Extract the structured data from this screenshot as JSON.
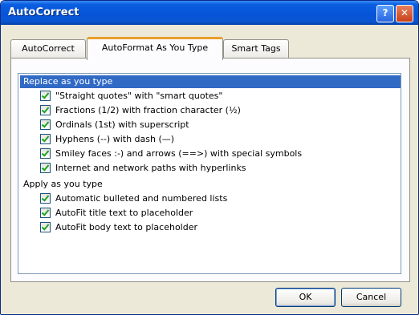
{
  "window": {
    "title": "AutoCorrect"
  },
  "titlebar_buttons": {
    "help": "?",
    "close": "✕"
  },
  "tabs": [
    {
      "label": "AutoCorrect",
      "active": false
    },
    {
      "label": "AutoFormat As You Type",
      "active": true
    },
    {
      "label": "Smart Tags",
      "active": false
    }
  ],
  "groups": [
    {
      "header": "Replace as you type",
      "selected": true,
      "items": [
        {
          "label": "\"Straight quotes\" with \"smart quotes\"",
          "checked": true
        },
        {
          "label": "Fractions (1/2) with fraction character (½)",
          "checked": true
        },
        {
          "label": "Ordinals (1st) with superscript",
          "checked": true
        },
        {
          "label": "Hyphens (--) with dash (—)",
          "checked": true
        },
        {
          "label": "Smiley faces :-) and arrows (==>) with special symbols",
          "checked": true
        },
        {
          "label": "Internet and network paths with hyperlinks",
          "checked": true
        }
      ]
    },
    {
      "header": "Apply as you type",
      "selected": false,
      "items": [
        {
          "label": "Automatic bulleted and numbered lists",
          "checked": true
        },
        {
          "label": "AutoFit title text to placeholder",
          "checked": true
        },
        {
          "label": "AutoFit body text to placeholder",
          "checked": true
        }
      ]
    }
  ],
  "buttons": {
    "ok": "OK",
    "cancel": "Cancel"
  },
  "colors": {
    "titlebar": "#0654d8",
    "selection": "#316ac5",
    "active_tab_accent": "#e99f2a",
    "checkmark": "#21a121"
  }
}
